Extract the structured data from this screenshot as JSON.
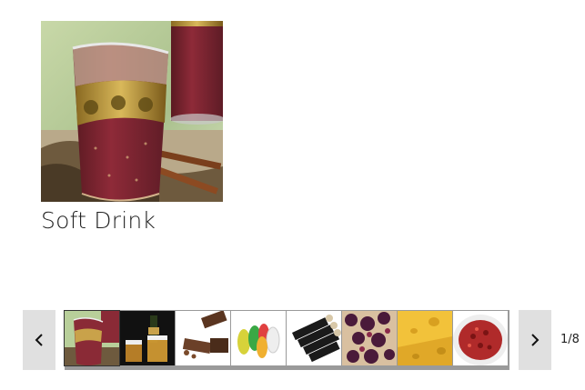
{
  "gallery": {
    "current_item": {
      "caption": "Soft Drink",
      "image": "tea-glass-with-cinnamon"
    },
    "counter": "1/8",
    "prev_icon": "chevron-left-icon",
    "next_icon": "chevron-right-icon",
    "thumbnails": [
      {
        "image": "tea-glass-with-cinnamon",
        "selected": true
      },
      {
        "image": "beer-glasses-and-bottle",
        "selected": false
      },
      {
        "image": "chocolate-pieces",
        "selected": false
      },
      {
        "image": "gummy-bears",
        "selected": false
      },
      {
        "image": "wine-bottles-rack",
        "selected": false
      },
      {
        "image": "berries-pastry",
        "selected": false
      },
      {
        "image": "cheese-block",
        "selected": false
      },
      {
        "image": "berry-dessert-bowl",
        "selected": false
      }
    ]
  }
}
